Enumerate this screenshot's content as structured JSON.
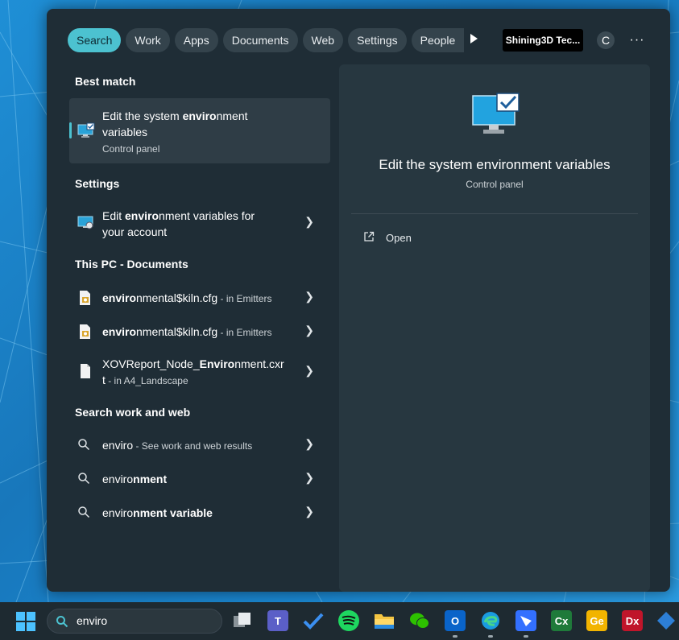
{
  "tabs": [
    "Search",
    "Work",
    "Apps",
    "Documents",
    "Web",
    "Settings",
    "People"
  ],
  "account": "Shining3D Tec...",
  "avatar_initial": "C",
  "more": "···",
  "sections": {
    "best_match": "Best match",
    "settings": "Settings",
    "this_pc": "This PC - Documents",
    "search_web": "Search work and web"
  },
  "best": {
    "title_pre": "Edit the system ",
    "title_bold": "enviro",
    "title_post": "nment",
    "title_line2": "variables",
    "sub": "Control panel"
  },
  "settings_item": {
    "pre": "Edit ",
    "bold": "enviro",
    "post": "nment variables for",
    "line2": "your account"
  },
  "docs": [
    {
      "bold": "enviro",
      "rest": "nmental$kiln.cfg",
      "loc": " - in Emitters"
    },
    {
      "bold": "enviro",
      "rest": "nmental$kiln.cfg",
      "loc": " - in Emitters"
    }
  ],
  "doc3": {
    "pre": "XOVReport_Node_",
    "bold": "Enviro",
    "post": "nment.cxr",
    "line2": "t",
    "loc": " - in A4_Landscape"
  },
  "web": [
    {
      "pre": "enviro",
      "bold": "",
      "note": " - See work and web results"
    },
    {
      "pre": "enviro",
      "bold": "nment",
      "note": ""
    },
    {
      "pre": "enviro",
      "bold": "nment variable",
      "note": ""
    }
  ],
  "preview": {
    "title": "Edit the system environment variables",
    "sub": "Control panel",
    "open": "Open"
  },
  "taskbar": {
    "query": "enviro",
    "apps": [
      "task-view",
      "teams",
      "todo",
      "spotify",
      "file-explorer",
      "wechat",
      "outlook",
      "edge",
      "feishu",
      "cx",
      "ge",
      "dx",
      "app"
    ]
  },
  "colors": {
    "accent": "#4cc2d0",
    "panel": "#1f2d36",
    "preview": "#273740"
  }
}
